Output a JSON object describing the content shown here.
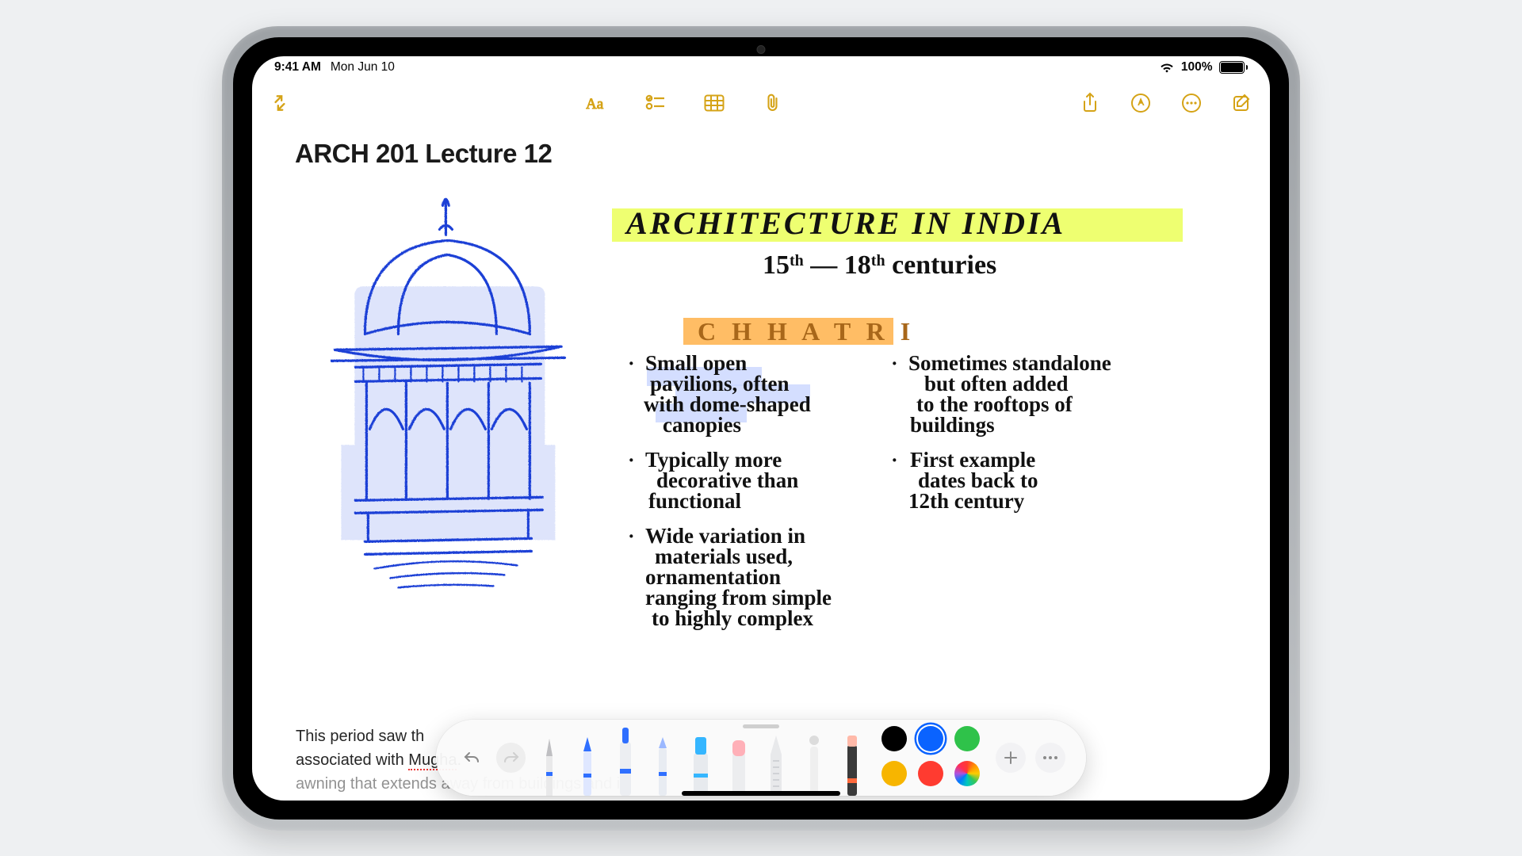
{
  "status": {
    "time": "9:41 AM",
    "date": "Mon Jun 10",
    "battery_pct": "100%"
  },
  "note": {
    "title": "ARCH 201 Lecture 12",
    "hand": {
      "heading": "ARCHITECTURE IN INDIA",
      "sub": "15th — 18th centuries",
      "section": "CHHATRI",
      "col1": [
        "Small open pavilions, often with dome-shaped canopies",
        "Typically more decorative than functional",
        "Wide variation in materials used, ornamentation ranging from simple to highly complex"
      ],
      "col2": [
        "Sometimes standalone but often added to the rooftops of buildings",
        "First example dates back to 12th century"
      ]
    },
    "typed": {
      "line1": "This period saw th",
      "line2a": "associated with ",
      "line2b": "Mugha",
      "line3": "awning that extends away from buildings and is"
    }
  },
  "toolkit": {
    "tools": [
      "pen",
      "pencil",
      "marker",
      "crayon",
      "highlighter",
      "eraser",
      "ruler",
      "lasso",
      "fill"
    ],
    "selected_tool": "marker",
    "colors": [
      "#000000",
      "#0a63ff",
      "#2fc24a",
      "#f7b500",
      "#ff3b30",
      "rainbow"
    ],
    "selected_color": "#0a63ff"
  }
}
